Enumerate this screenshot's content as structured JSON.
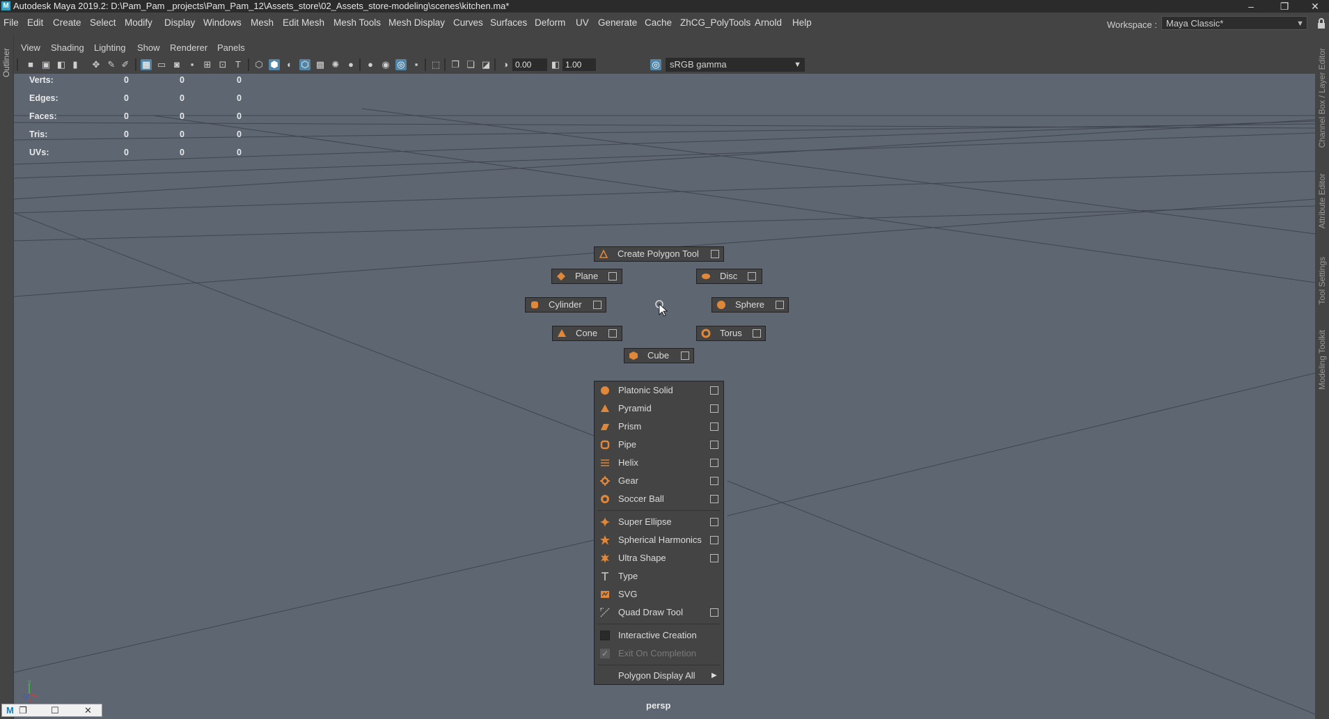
{
  "window": {
    "title": "Autodesk Maya 2019.2: D:\\Pam_Pam _projects\\Pam_Pam_12\\Assets_store\\02_Assets_store-modeling\\scenes\\kitchen.ma*",
    "logo": "M",
    "minimize": "–",
    "restore": "❐",
    "close": "✕"
  },
  "menubar": {
    "items": [
      "File",
      "Edit",
      "Create",
      "Select",
      "Modify",
      "Display",
      "Windows",
      "Mesh",
      "Edit Mesh",
      "Mesh Tools",
      "Mesh Display",
      "Curves",
      "Surfaces",
      "Deform",
      "UV",
      "Generate",
      "Cache",
      "ZhCG_PolyTools",
      "Arnold",
      "Help"
    ],
    "workspace_label": "Workspace :",
    "workspace_value": "Maya Classic*"
  },
  "left_tabs": [
    "Outliner"
  ],
  "right_tabs": [
    "Channel Box / Layer Editor",
    "Attribute Editor",
    "Tool Settings",
    "Modeling Toolkit"
  ],
  "panel_menu": [
    "View",
    "Shading",
    "Lighting",
    "Show",
    "Renderer",
    "Panels"
  ],
  "toolbar": {
    "exposure": "0.00",
    "gamma": "1.00",
    "color_management": "sRGB gamma"
  },
  "hud": {
    "rows": [
      {
        "label": "Verts:",
        "values": [
          "0",
          "0",
          "0"
        ]
      },
      {
        "label": "Edges:",
        "values": [
          "0",
          "0",
          "0"
        ]
      },
      {
        "label": "Faces:",
        "values": [
          "0",
          "0",
          "0"
        ]
      },
      {
        "label": "Tris:",
        "values": [
          "0",
          "0",
          "0"
        ]
      },
      {
        "label": "UVs:",
        "values": [
          "0",
          "0",
          "0"
        ]
      }
    ]
  },
  "marking_menu": {
    "north": "Create Polygon Tool",
    "nw": "Plane",
    "ne": "Disc",
    "w": "Cylinder",
    "e": "Sphere",
    "sw": "Cone",
    "se": "Torus",
    "s": "Cube"
  },
  "dropdown": {
    "items": [
      "Platonic Solid",
      "Pyramid",
      "Prism",
      "Pipe",
      "Helix",
      "Gear",
      "Soccer Ball"
    ],
    "items2": [
      "Super Ellipse",
      "Spherical Harmonics",
      "Ultra Shape",
      "Type",
      "SVG",
      "Quad Draw Tool"
    ],
    "interactive_creation": "Interactive Creation",
    "exit_on_completion": "Exit On Completion",
    "polygon_display_all": "Polygon Display All"
  },
  "viewport": {
    "camera": "persp",
    "axis_x": "x",
    "axis_y": "y",
    "axis_z": "z"
  },
  "colors": {
    "accent_orange": "#e0873a",
    "viewport_bg": "#5e6672",
    "ui_bg": "#444444",
    "active_blue": "#5285a6"
  }
}
